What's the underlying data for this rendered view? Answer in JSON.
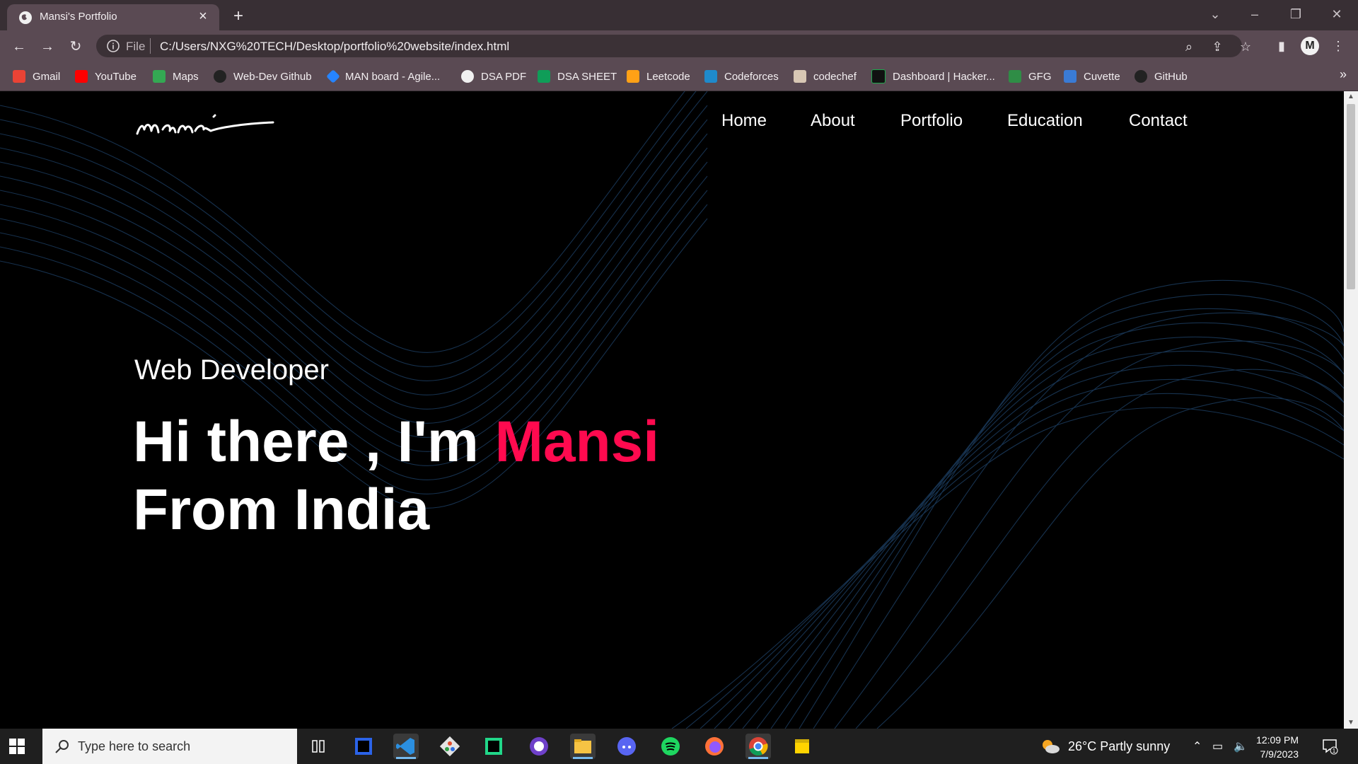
{
  "browser": {
    "tab_title": "Mansi's Portfolio",
    "new_tab_label": "+",
    "address": {
      "scheme_label": "File",
      "url": "C:/Users/NXG%20TECH/Desktop/portfolio%20website/index.html"
    },
    "profile_initial": "M",
    "bookmarks": [
      {
        "label": "Gmail",
        "icon": "gmail-icon",
        "color": "#ea4335"
      },
      {
        "label": "YouTube",
        "icon": "youtube-icon",
        "color": "#ff0000"
      },
      {
        "label": "Maps",
        "icon": "maps-icon",
        "color": "#34a853"
      },
      {
        "label": "Web-Dev Github",
        "icon": "github-icon",
        "color": "#222222"
      },
      {
        "label": "MAN board - Agile...",
        "icon": "jira-icon",
        "color": "#2684ff"
      },
      {
        "label": "DSA PDF",
        "icon": "globe-icon",
        "color": "#ffffff"
      },
      {
        "label": "DSA SHEET",
        "icon": "sheets-icon",
        "color": "#0f9d58"
      },
      {
        "label": "Leetcode",
        "icon": "leetcode-icon",
        "color": "#ffa116"
      },
      {
        "label": "Codeforces",
        "icon": "codeforces-icon",
        "color": "#1f8acb"
      },
      {
        "label": "codechef",
        "icon": "codechef-icon",
        "color": "#5b4638"
      },
      {
        "label": "Dashboard | Hacker...",
        "icon": "hackerrank-icon",
        "color": "#1ba94c"
      },
      {
        "label": "GFG",
        "icon": "gfg-icon",
        "color": "#2f8d46"
      },
      {
        "label": "Cuvette",
        "icon": "cuvette-icon",
        "color": "#3a7bd5"
      },
      {
        "label": "GitHub",
        "icon": "github-icon",
        "color": "#222222"
      }
    ],
    "more_bookmarks": "»"
  },
  "page": {
    "nav": [
      "Home",
      "About",
      "Portfolio",
      "Education",
      "Contact"
    ],
    "role": "Web Developer",
    "greeting_prefix": "Hi there , I'm",
    "name": "Mansi",
    "greeting_line2": "From India",
    "accent_color": "#ff0a4f"
  },
  "taskbar": {
    "search_placeholder": "Type here to search",
    "apps": [
      "task-view-icon",
      "intellij-icon",
      "vscode-icon",
      "git-icon",
      "pycharm-icon",
      "github-desktop-icon",
      "file-explorer-icon",
      "discord-icon",
      "spotify-icon",
      "firefox-icon",
      "chrome-icon",
      "sticky-notes-icon"
    ],
    "weather": "26°C  Partly sunny",
    "time": "12:09 PM",
    "date": "7/9/2023",
    "notification_count": "1"
  }
}
